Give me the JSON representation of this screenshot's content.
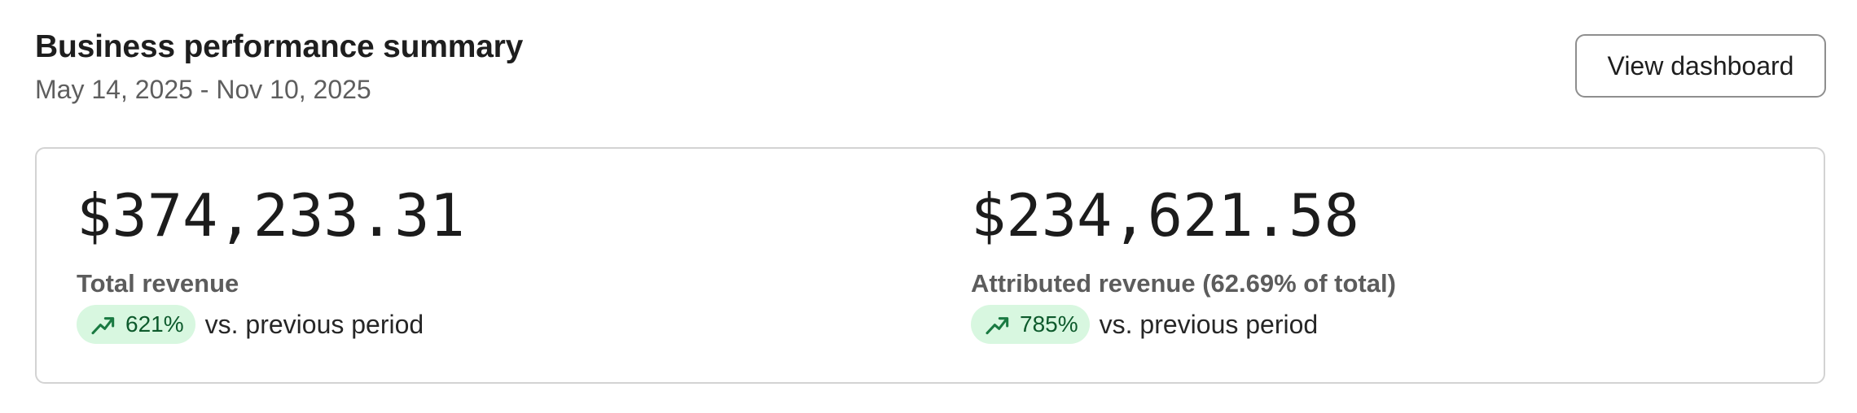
{
  "header": {
    "title": "Business performance summary",
    "date_range": "May 14, 2025 - Nov 10, 2025",
    "view_button_label": "View dashboard"
  },
  "metrics": [
    {
      "value": "$374,233.31",
      "label": "Total revenue",
      "change": "621%",
      "change_direction": "up",
      "comparison": "vs. previous period",
      "trend_icon": "trending-up-icon"
    },
    {
      "value": "$234,621.58",
      "label": "Attributed revenue (62.69% of total)",
      "change": "785%",
      "change_direction": "up",
      "comparison": "vs. previous period",
      "trend_icon": "trending-up-icon"
    }
  ],
  "colors": {
    "badge_background": "#d8f7e0",
    "badge_text": "#0d5a2c",
    "trend_icon": "#1a7a42",
    "card_border": "#d3d3d3",
    "button_border": "#8e8e8e"
  }
}
